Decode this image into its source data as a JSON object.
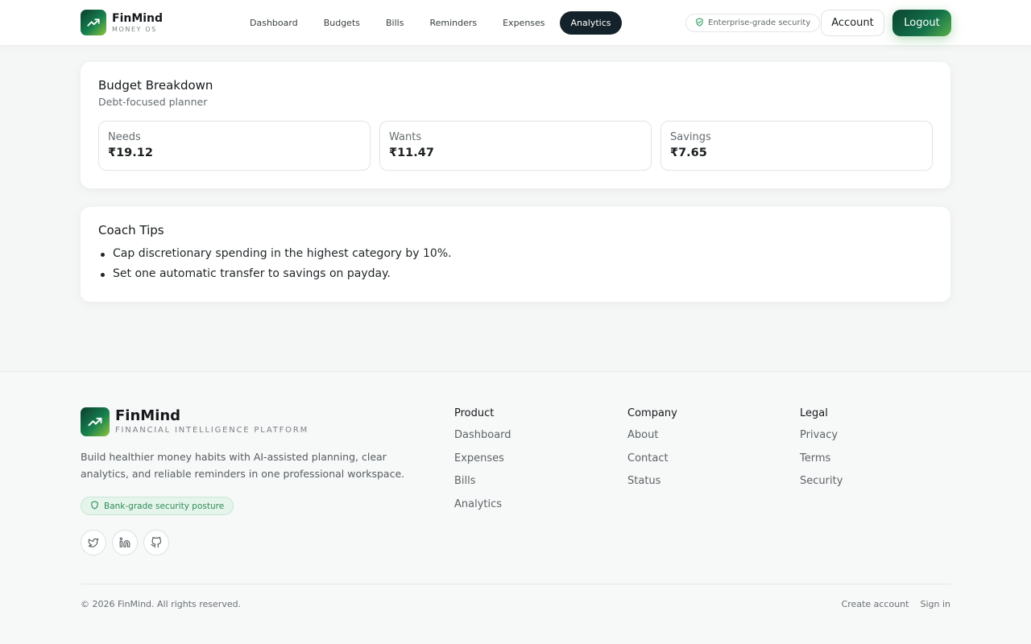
{
  "header": {
    "brand_name": "FinMind",
    "brand_sub": "MONEY OS",
    "nav": [
      {
        "label": "Dashboard"
      },
      {
        "label": "Budgets"
      },
      {
        "label": "Bills"
      },
      {
        "label": "Reminders"
      },
      {
        "label": "Expenses"
      },
      {
        "label": "Analytics",
        "active": true
      }
    ],
    "security_label": "Enterprise-grade security",
    "account_label": "Account",
    "logout_label": "Logout"
  },
  "budget": {
    "title": "Budget Breakdown",
    "subtitle": "Debt-focused planner",
    "stats": [
      {
        "label": "Needs",
        "value": "₹19.12"
      },
      {
        "label": "Wants",
        "value": "₹11.47"
      },
      {
        "label": "Savings",
        "value": "₹7.65"
      }
    ]
  },
  "tips": {
    "title": "Coach Tips",
    "items": [
      "Cap discretionary spending in the highest category by 10%.",
      "Set one automatic transfer to savings on payday."
    ]
  },
  "footer": {
    "brand_name": "FinMind",
    "brand_sub": "FINANCIAL INTELLIGENCE PLATFORM",
    "description": "Build healthier money habits with AI-assisted planning, clear analytics, and reliable reminders in one professional workspace.",
    "badge": "Bank-grade security posture",
    "socials": [
      "twitter-icon",
      "linkedin-icon",
      "github-icon"
    ],
    "columns": [
      {
        "title": "Product",
        "links": [
          "Dashboard",
          "Expenses",
          "Bills",
          "Analytics"
        ]
      },
      {
        "title": "Company",
        "links": [
          "About",
          "Contact",
          "Status"
        ]
      },
      {
        "title": "Legal",
        "links": [
          "Privacy",
          "Terms",
          "Security"
        ]
      }
    ],
    "copyright": "© 2026 FinMind. All rights reserved.",
    "bottom_links": [
      "Create account",
      "Sign in"
    ]
  },
  "colors": {
    "accent": "#16804f",
    "nav_active_bg": "#14232b",
    "badge_bg": "#e6f5ec",
    "badge_text": "#2f8a57"
  }
}
